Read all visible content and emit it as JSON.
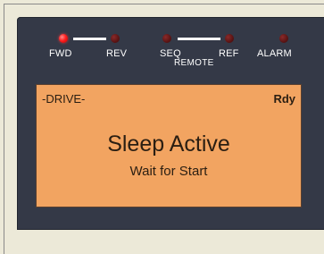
{
  "indicators": {
    "fwd_label": "FWD",
    "rev_label": "REV",
    "seq_label": "SEQ",
    "ref_label": "REF",
    "remote_label": "REMOTE",
    "alarm_label": "ALARM"
  },
  "display": {
    "mode": "-DRIVE-",
    "status": "Rdy",
    "message": "Sleep Active",
    "submessage": "Wait for Start"
  },
  "colors": {
    "panel": "#343947",
    "lcd_background": "#f2a461",
    "led_on": "#ff2020",
    "led_off": "#5a1414"
  }
}
